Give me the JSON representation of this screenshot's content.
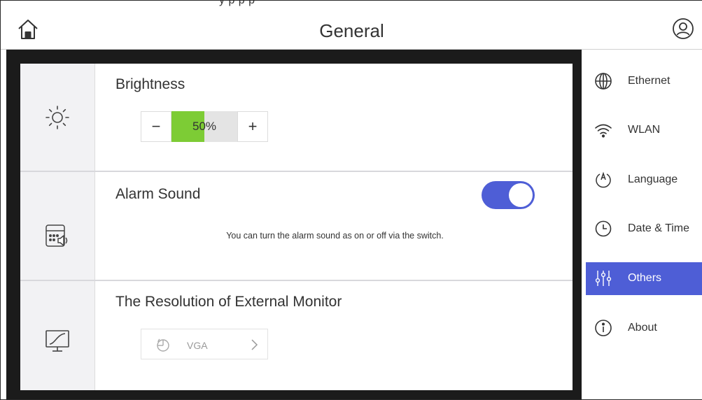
{
  "header": {
    "clipped_text": "y                        p    p         p",
    "title": "General"
  },
  "settings": {
    "brightness": {
      "label": "Brightness",
      "minus": "−",
      "plus": "+",
      "value_text": "50%",
      "level_fraction": 0.5
    },
    "alarm": {
      "label": "Alarm Sound",
      "enabled": true,
      "hint": "You can turn the alarm sound as on or off via the switch."
    },
    "resolution": {
      "label": "The Resolution of External Monitor",
      "value": "VGA"
    }
  },
  "nav": {
    "items": [
      {
        "label": "Ethernet",
        "icon": "globe-icon"
      },
      {
        "label": "WLAN",
        "icon": "wifi-icon"
      },
      {
        "label": "Language",
        "icon": "language-icon"
      },
      {
        "label": "Date & Time",
        "icon": "clock-icon"
      },
      {
        "label": "Others",
        "icon": "sliders-icon",
        "active": true
      },
      {
        "label": "About",
        "icon": "info-icon"
      }
    ]
  },
  "colors": {
    "accent": "#4e5ed6",
    "brightness_fill": "#7dcc35",
    "panel_bg": "#1b1b1b"
  }
}
